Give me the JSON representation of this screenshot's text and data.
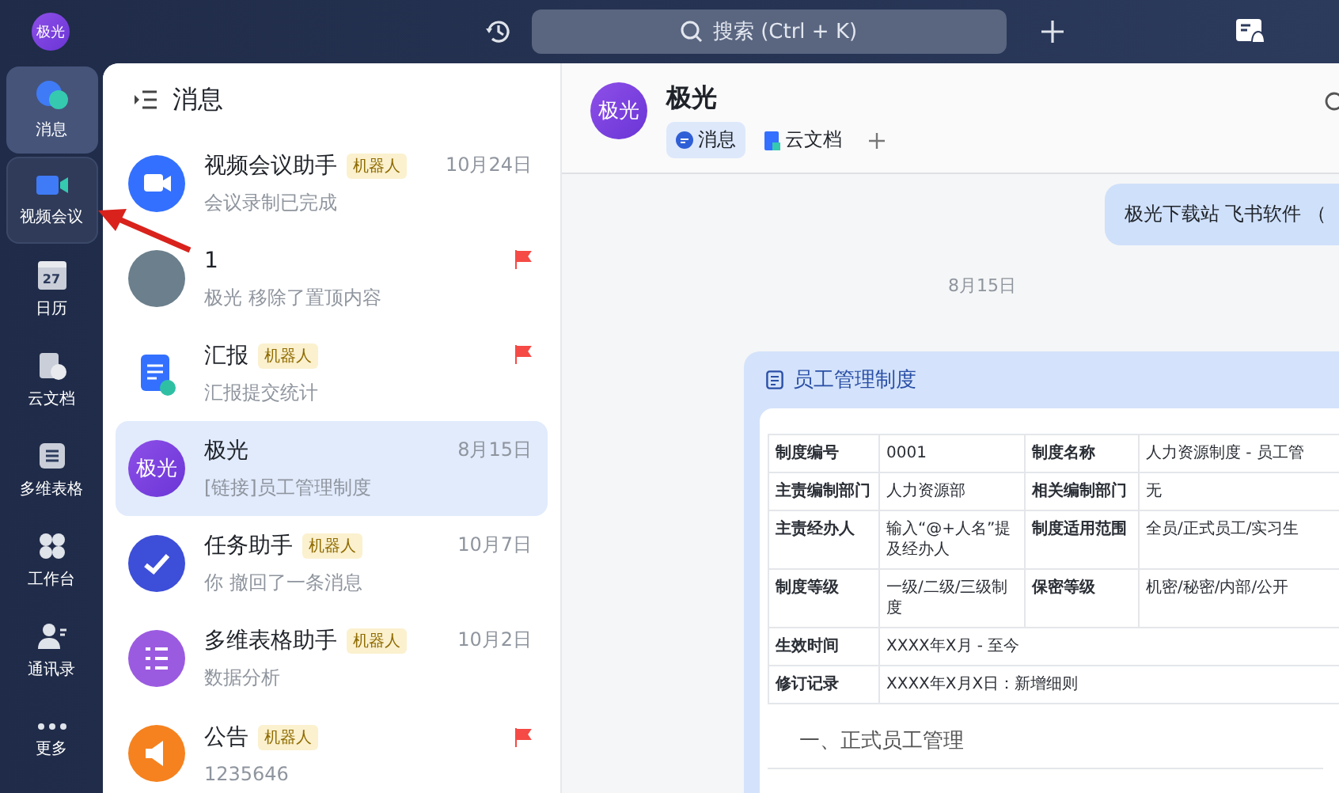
{
  "top_bar": {
    "avatar": "极光",
    "search": {
      "placeholder": "搜索 (Ctrl + K)"
    }
  },
  "rail": [
    {
      "label": "消息",
      "selected": true,
      "hovered": false
    },
    {
      "label": "视频会议",
      "selected": false,
      "hovered": true
    },
    {
      "label": "日历",
      "badge": "27",
      "selected": false,
      "hovered": false
    },
    {
      "label": "云文档",
      "selected": false,
      "hovered": false
    },
    {
      "label": "多维表格",
      "selected": false,
      "hovered": false
    },
    {
      "label": "工作台",
      "selected": false,
      "hovered": false
    },
    {
      "label": "通讯录",
      "selected": false,
      "hovered": false
    },
    {
      "label": "更多",
      "selected": false,
      "hovered": false
    }
  ],
  "chat_list": {
    "title": "消息",
    "items": [
      {
        "kind": "video",
        "name": "视频会议助手",
        "tag": "机器人",
        "time": "10月24日",
        "preview": "会议录制已完成",
        "flagged": false,
        "selected": false
      },
      {
        "kind": "photo",
        "name": "1",
        "preview": "极光 移除了置顶内容",
        "flagged": true,
        "selected": false
      },
      {
        "kind": "report",
        "name": "汇报",
        "tag": "机器人",
        "preview": "汇报提交统计",
        "flagged": true,
        "selected": false
      },
      {
        "kind": "text",
        "avatar": "极光",
        "name": "极光",
        "time": "8月15日",
        "preview": "[链接]员工管理制度",
        "flagged": false,
        "selected": true
      },
      {
        "kind": "task",
        "name": "任务助手",
        "tag": "机器人",
        "time": "10月7日",
        "preview": "你 撤回了一条消息",
        "flagged": false,
        "selected": false
      },
      {
        "kind": "table",
        "name": "多维表格助手",
        "tag": "机器人",
        "time": "10月2日",
        "preview": "数据分析",
        "flagged": false,
        "selected": false
      },
      {
        "kind": "notice",
        "name": "公告",
        "tag": "机器人",
        "preview": "1235646",
        "flagged": true,
        "selected": false
      }
    ]
  },
  "chat": {
    "avatar": "极光",
    "title": "极光",
    "tabs": [
      {
        "label": "消息",
        "selected": true
      },
      {
        "label": "云文档",
        "selected": false
      }
    ],
    "bubble": "极光下载站 飞书软件 （",
    "date": "8月15日",
    "card": {
      "title": "员工管理制度",
      "rows": [
        [
          {
            "text": "制度编号"
          },
          {
            "text": "0001"
          },
          {
            "text": "制度名称"
          },
          {
            "text": "人力资源制度 - 员工管"
          }
        ],
        [
          {
            "text": "主责编制部门"
          },
          {
            "text": "人力资源部"
          },
          {
            "text": "相关编制部门"
          },
          {
            "text": "无"
          }
        ],
        [
          {
            "text": "主责经办人"
          },
          {
            "text": "输入“@+人名”提及经办人"
          },
          {
            "text": "制度适用范围"
          },
          {
            "text": "全员/正式员工/实习生"
          }
        ],
        [
          {
            "text": "制度等级"
          },
          {
            "text": "一级/二级/三级制度"
          },
          {
            "text": "保密等级"
          },
          {
            "text": "机密/秘密/内部/公开"
          }
        ],
        [
          {
            "text": "生效时间"
          },
          {
            "text": "XXXX年X月 - 至今",
            "colspan": 3
          }
        ],
        [
          {
            "text": "修订记录"
          },
          {
            "text": "XXXX年X月X日：新增细则",
            "colspan": 3
          }
        ]
      ],
      "section": "一、正式员工管理"
    }
  }
}
